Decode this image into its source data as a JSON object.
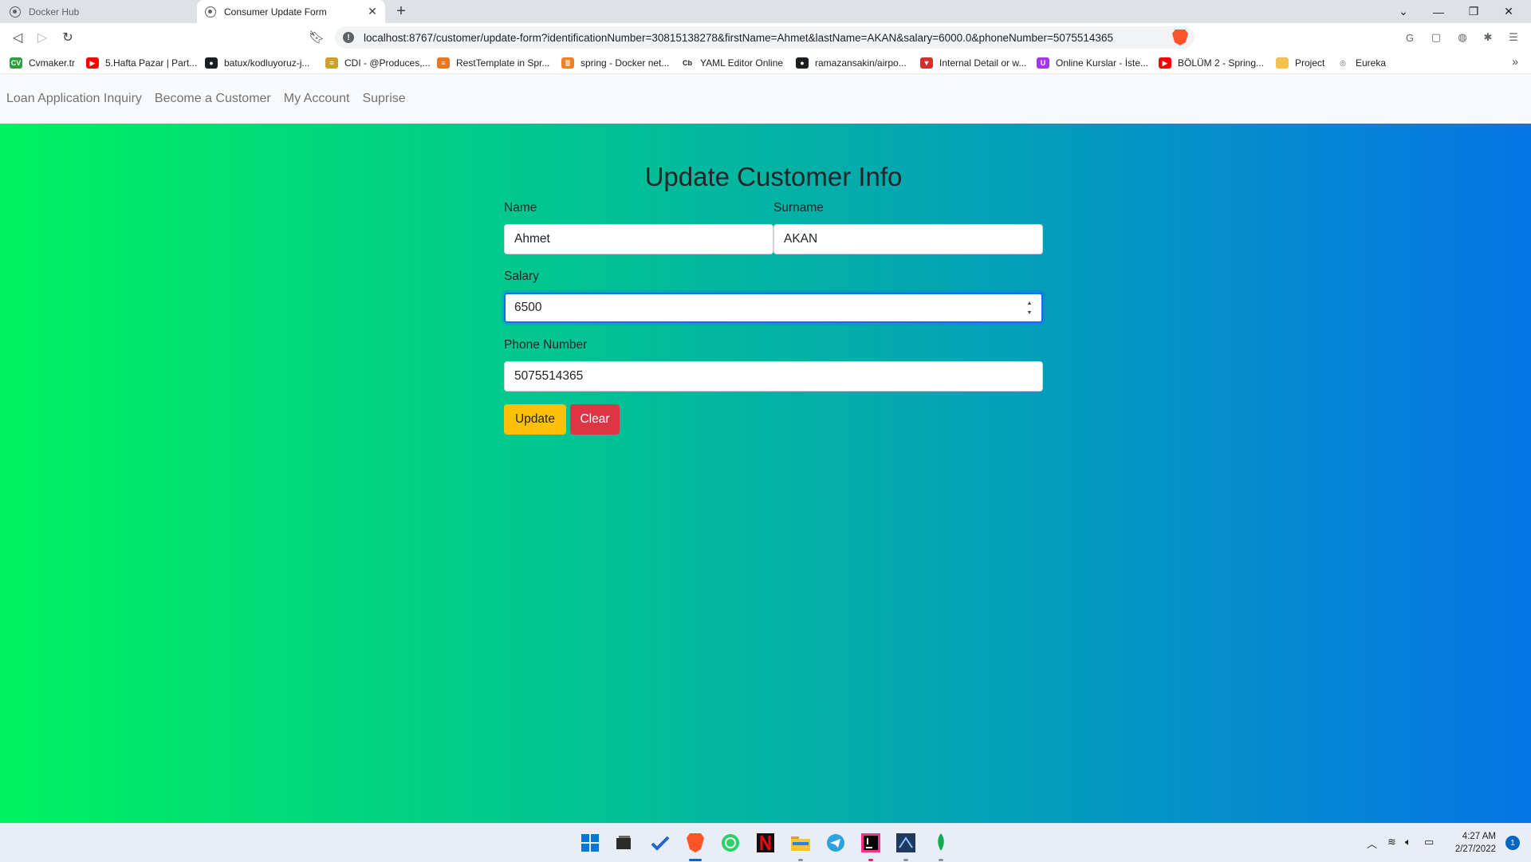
{
  "browser": {
    "tabs": [
      {
        "title": "Docker Hub",
        "active": false
      },
      {
        "title": "Consumer Update Form",
        "active": true
      }
    ],
    "url": "localhost:8767/customer/update-form?identificationNumber=30815138278&firstName=Ahmet&lastName=AKAN&salary=6000.0&phoneNumber=5075514365",
    "bookmarks": [
      {
        "label": "Cvmaker.tr",
        "icon": "cv-icon",
        "color": "#2e9e3f"
      },
      {
        "label": "5.Hafta Pazar | Part...",
        "icon": "youtube-icon",
        "color": "#ff0000"
      },
      {
        "label": "batux/kodluyoruz-j...",
        "icon": "github-icon",
        "color": "#1b1f23"
      },
      {
        "label": "CDI - @Produces,...",
        "icon": "page-icon",
        "color": "#c9a227"
      },
      {
        "label": "RestTemplate in Spr...",
        "icon": "page-icon",
        "color": "#e87722"
      },
      {
        "label": "spring - Docker net...",
        "icon": "stackoverflow-icon",
        "color": "#f48024"
      },
      {
        "label": "YAML Editor Online",
        "icon": "cb-icon",
        "color": "#202124"
      },
      {
        "label": "ramazansakin/airpo...",
        "icon": "github-icon",
        "color": "#1b1f23"
      },
      {
        "label": "Internal Detail or w...",
        "icon": "vuetify-icon",
        "color": "#d32f2f"
      },
      {
        "label": "Online Kurslar - İste...",
        "icon": "udemy-icon",
        "color": "#a435f0"
      },
      {
        "label": "BÖLÜM 2 - Spring...",
        "icon": "youtube-icon",
        "color": "#ff0000"
      },
      {
        "label": "Project",
        "icon": "folder-icon",
        "color": "#f2c14e"
      },
      {
        "label": "Eureka",
        "icon": "globe-icon",
        "color": "#5f6368"
      }
    ]
  },
  "navbar": {
    "links": [
      "Loan Application Inquiry",
      "Become a Customer",
      "My Account",
      "Suprise"
    ]
  },
  "form": {
    "title": "Update Customer Info",
    "name_label": "Name",
    "name_value": "Ahmet",
    "surname_label": "Surname",
    "surname_value": "AKAN",
    "salary_label": "Salary",
    "salary_value": "6500",
    "phone_label": "Phone Number",
    "phone_value": "5075514365",
    "update_label": "Update",
    "clear_label": "Clear"
  },
  "taskbar": {
    "time": "4:27 AM",
    "date": "2/27/2022",
    "notification_count": "1"
  },
  "colors": {
    "gradient_start": "#00f260",
    "gradient_end": "#0575e6",
    "update_button": "#ffc107",
    "clear_button": "#dc3545"
  }
}
